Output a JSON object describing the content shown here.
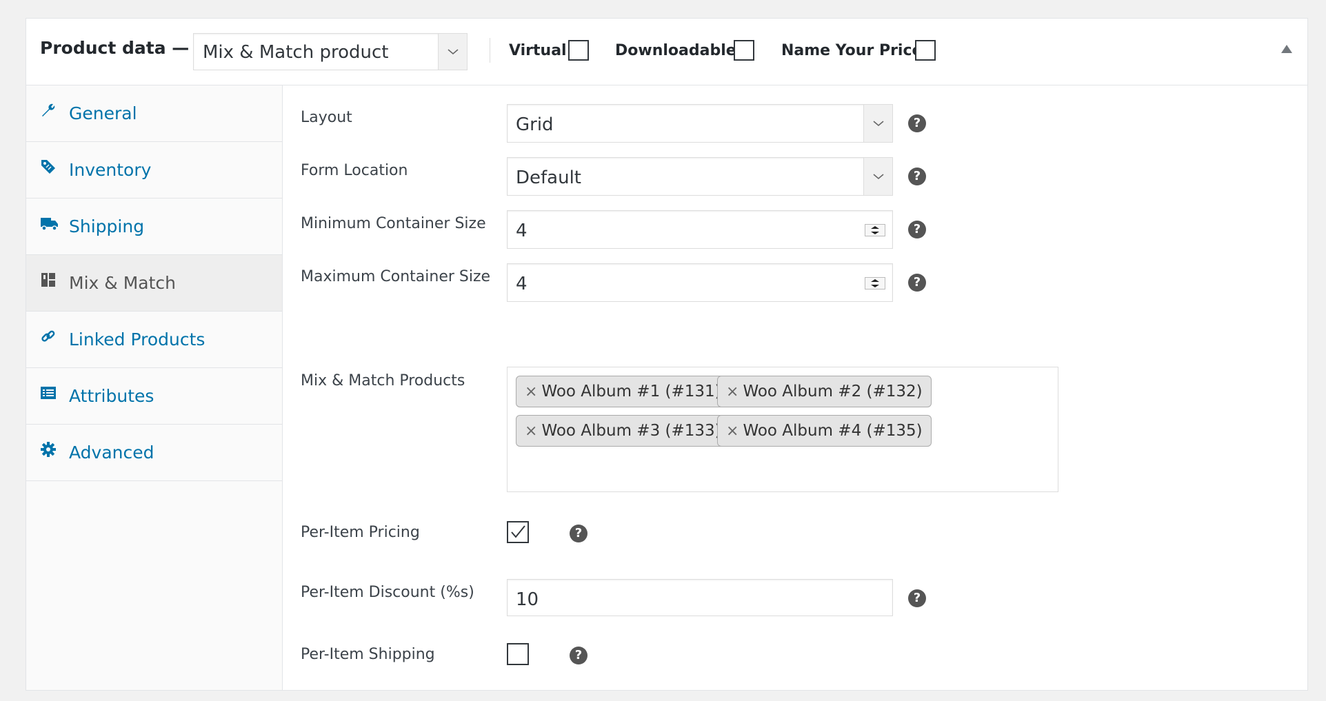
{
  "header": {
    "title": "Product data —",
    "product_type": "Mix & Match product",
    "virtual_label": "Virtual:",
    "downloadable_label": "Downloadable:",
    "name_your_price_label": "Name Your Price:"
  },
  "sidebar": {
    "items": [
      {
        "label": "General",
        "icon": "wrench-icon"
      },
      {
        "label": "Inventory",
        "icon": "tag-icon"
      },
      {
        "label": "Shipping",
        "icon": "truck-icon"
      },
      {
        "label": "Mix & Match",
        "icon": "grid-icon"
      },
      {
        "label": "Linked Products",
        "icon": "link-icon"
      },
      {
        "label": "Attributes",
        "icon": "list-icon"
      },
      {
        "label": "Advanced",
        "icon": "gear-icon"
      }
    ],
    "active": "Mix & Match"
  },
  "form": {
    "layout": {
      "label": "Layout",
      "value": "Grid"
    },
    "form_location": {
      "label": "Form Location",
      "value": "Default"
    },
    "min_size": {
      "label": "Minimum Container Size",
      "value": "4"
    },
    "max_size": {
      "label": "Maximum Container Size",
      "value": "4"
    },
    "products": {
      "label": "Mix & Match Products",
      "items": [
        "Woo Album #1 (#131)",
        "Woo Album #2 (#132)",
        "Woo Album #3 (#133)",
        "Woo Album #4 (#135)"
      ]
    },
    "per_item_pricing": {
      "label": "Per-Item Pricing",
      "checked": true
    },
    "per_item_discount": {
      "label": "Per-Item Discount (%s)",
      "value": "10"
    },
    "per_item_shipping": {
      "label": "Per-Item Shipping",
      "checked": false
    },
    "help_glyph": "?",
    "remove_glyph": "×"
  },
  "colors": {
    "link": "#0073aa",
    "active_tab_bg": "#eeeeee",
    "help_bg": "#555555"
  }
}
